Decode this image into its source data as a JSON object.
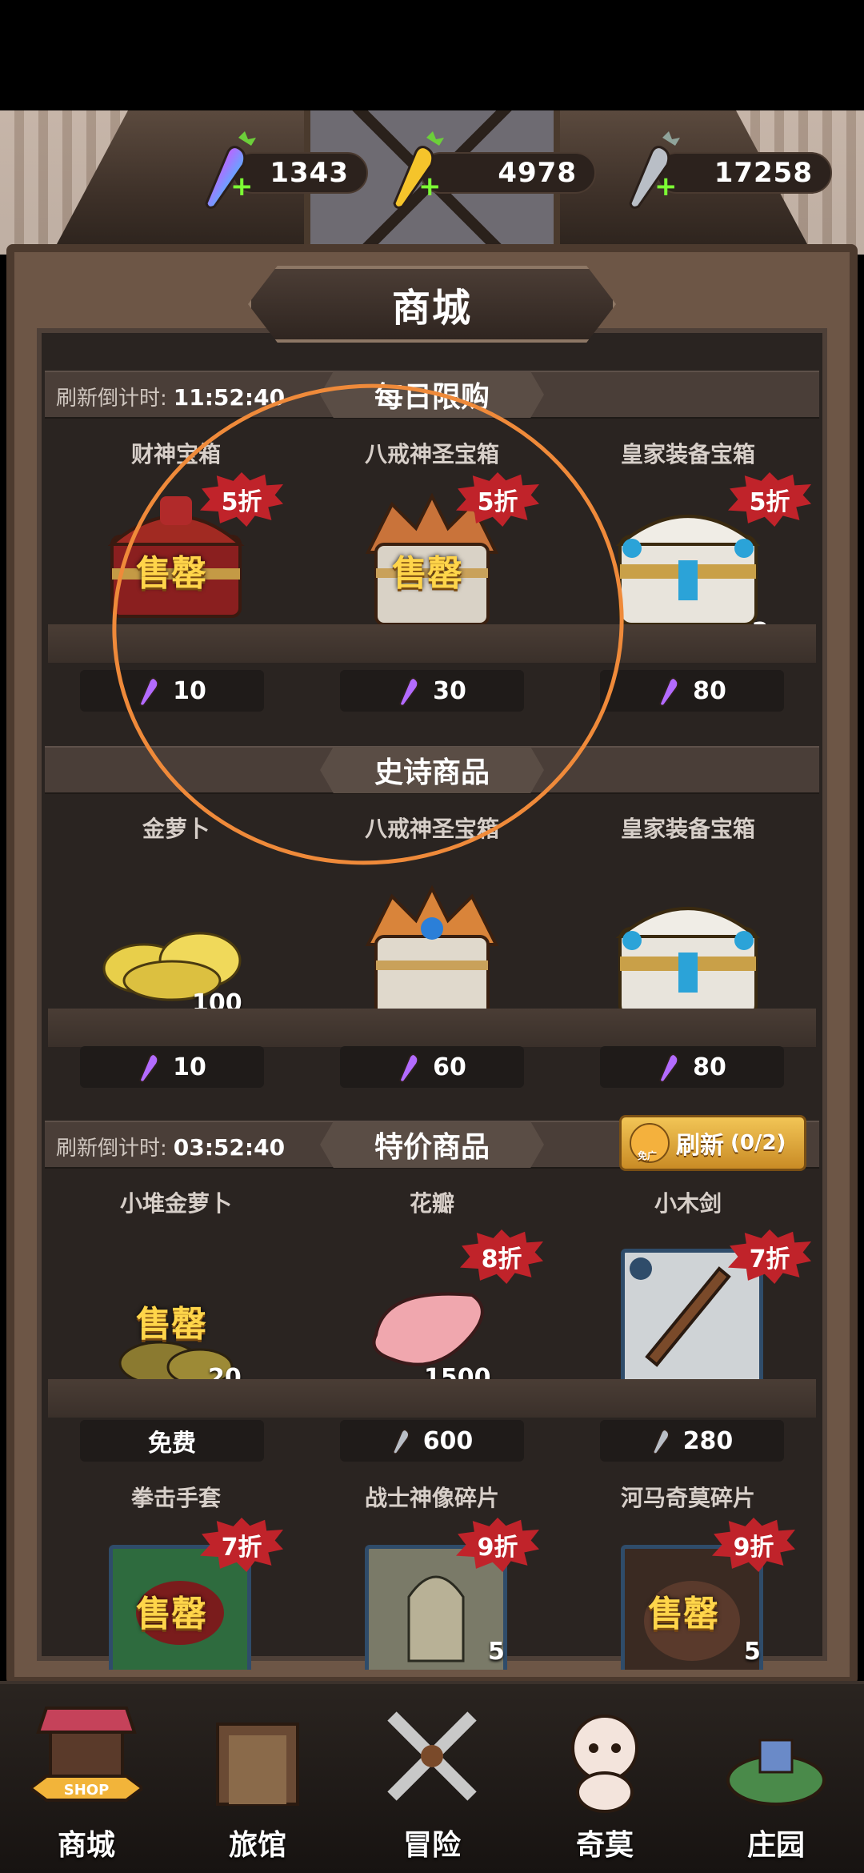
{
  "currencies": [
    {
      "name": "rainbow-carrot",
      "value": "1343",
      "color": "#c68cff"
    },
    {
      "name": "gold-carrot",
      "value": "4978",
      "color": "#f5c42b"
    },
    {
      "name": "silver-carrot",
      "value": "17258",
      "color": "#b9bec6"
    }
  ],
  "shop_title": "商城",
  "daily": {
    "title": "每日限购",
    "timer_label": "刷新倒计时:",
    "timer_value": "11:52:40",
    "items": [
      {
        "name": "财神宝箱",
        "discount": "5折",
        "status": "售罄",
        "qty": "",
        "price": "10",
        "currency": "rainbow-carrot"
      },
      {
        "name": "八戒神圣宝箱",
        "discount": "5折",
        "status": "售罄",
        "qty": "",
        "price": "30",
        "currency": "rainbow-carrot"
      },
      {
        "name": "皇家装备宝箱",
        "discount": "5折",
        "status": "",
        "qty": "2",
        "price": "80",
        "currency": "rainbow-carrot"
      }
    ]
  },
  "epic": {
    "title": "史诗商品",
    "items": [
      {
        "name": "金萝卜",
        "qty": "100",
        "price": "10",
        "currency": "rainbow-carrot"
      },
      {
        "name": "八戒神圣宝箱",
        "qty": "",
        "price": "60",
        "currency": "rainbow-carrot"
      },
      {
        "name": "皇家装备宝箱",
        "qty": "",
        "price": "80",
        "currency": "rainbow-carrot"
      }
    ]
  },
  "special": {
    "title": "特价商品",
    "timer_label": "刷新倒计时:",
    "timer_value": "03:52:40",
    "refresh_label": "刷新",
    "refresh_count": "(0/2)",
    "ad_free_label": "免广",
    "items": [
      {
        "name": "小堆金萝卜",
        "discount": "",
        "status": "售罄",
        "qty": "20",
        "price": "免费",
        "currency": ""
      },
      {
        "name": "花瓣",
        "discount": "8折",
        "status": "",
        "qty": "1500",
        "price": "600",
        "currency": "silver-carrot"
      },
      {
        "name": "小木剑",
        "discount": "7折",
        "status": "",
        "qty": "",
        "price": "280",
        "currency": "silver-carrot"
      }
    ],
    "items_row2": [
      {
        "name": "拳击手套",
        "discount": "7折",
        "status": "售罄",
        "qty": ""
      },
      {
        "name": "战士神像碎片",
        "discount": "9折",
        "status": "",
        "qty": "5"
      },
      {
        "name": "河马奇莫碎片",
        "discount": "9折",
        "status": "售罄",
        "qty": "5"
      }
    ]
  },
  "nav": [
    {
      "label": "商城",
      "badge": "SHOP",
      "active": true
    },
    {
      "label": "旅馆",
      "active": false
    },
    {
      "label": "冒险",
      "active": false
    },
    {
      "label": "奇莫",
      "active": false
    },
    {
      "label": "庄园",
      "active": false
    }
  ],
  "colors": {
    "accent": "#ef8a3a",
    "discount": "#c0232a",
    "soldout": "#ffd54a"
  }
}
